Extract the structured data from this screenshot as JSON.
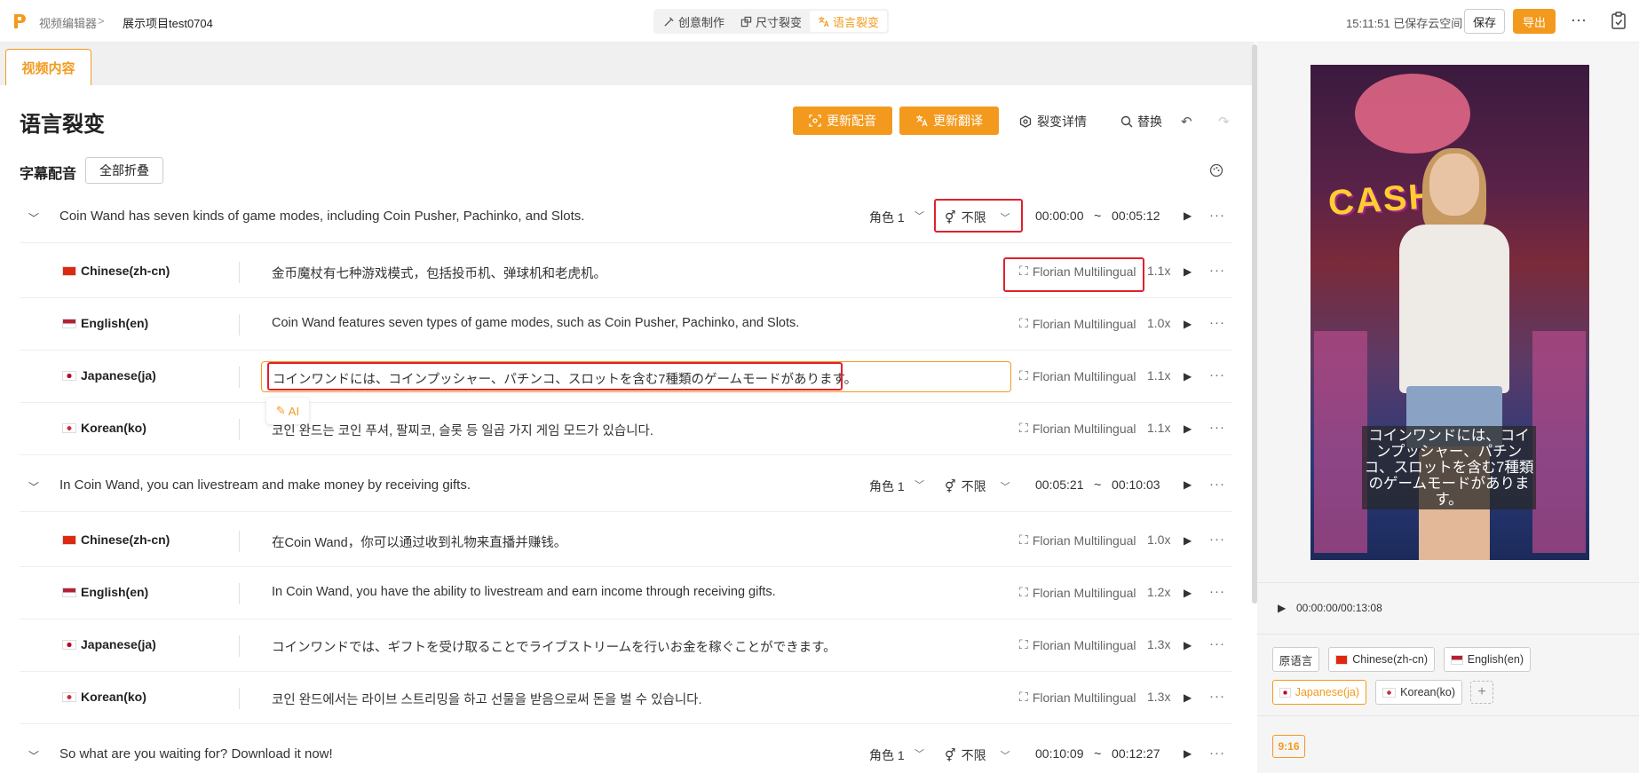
{
  "header": {
    "breadcrumb_root": "视频编辑器",
    "breadcrumb_sep": ">",
    "project_name": "展示项目test0704",
    "modes": [
      {
        "label": "创意制作",
        "icon": "creative-icon"
      },
      {
        "label": "尺寸裂变",
        "icon": "resize-icon"
      },
      {
        "label": "语言裂变",
        "icon": "translate-icon",
        "active": true
      }
    ],
    "save_status": "15:11:51 已保存云空间",
    "save_label": "保存",
    "export_label": "导出",
    "more": "···"
  },
  "tabs": {
    "video_content": "视频内容"
  },
  "toolbar": {
    "title": "语言裂变",
    "update_dub": "更新配音",
    "update_translate": "更新翻译",
    "detail": "裂变详情",
    "replace": "替换",
    "undo": "↶",
    "redo": "↷"
  },
  "subtitle_dub": {
    "label": "字幕配音",
    "collapse_all": "全部折叠"
  },
  "segments": [
    {
      "text": "Coin Wand has seven kinds of game modes, including Coin Pusher, Pachinko, and Slots.",
      "role": "角色 1",
      "gender": "不限",
      "start": "00:00:00",
      "tilde": "~",
      "end": "00:05:12",
      "langs": [
        {
          "name": "Chinese(zh-cn)",
          "text": "金币魔杖有七种游戏模式，包括投币机、弹球机和老虎机。",
          "voice": "Florian Multilingual",
          "speed": "1.1x"
        },
        {
          "name": "English(en)",
          "text": "Coin Wand features seven types of game modes, such as Coin Pusher, Pachinko, and Slots.",
          "voice": "Florian Multilingual",
          "speed": "1.0x"
        },
        {
          "name": "Japanese(ja)",
          "text": "コインワンドには、コインプッシャー、パチンコ、スロットを含む7種類のゲームモードがあります。",
          "voice": "Florian Multilingual",
          "speed": "1.1x"
        },
        {
          "name": "Korean(ko)",
          "text": "코인 완드는 코인 푸셔, 팔찌코, 슬롯 등 일곱 가지 게임 모드가 있습니다.",
          "voice": "Florian Multilingual",
          "speed": "1.1x"
        }
      ]
    },
    {
      "text": "In Coin Wand, you can livestream and make money by receiving gifts.",
      "role": "角色 1",
      "gender": "不限",
      "start": "00:05:21",
      "tilde": "~",
      "end": "00:10:03",
      "langs": [
        {
          "name": "Chinese(zh-cn)",
          "text": "在Coin Wand，你可以通过收到礼物来直播并赚钱。",
          "voice": "Florian Multilingual",
          "speed": "1.0x"
        },
        {
          "name": "English(en)",
          "text": "In Coin Wand, you have the ability to livestream and earn income through receiving gifts.",
          "voice": "Florian Multilingual",
          "speed": "1.2x"
        },
        {
          "name": "Japanese(ja)",
          "text": "コインワンドでは、ギフトを受け取ることでライブストリームを行いお金を稼ぐことができます。",
          "voice": "Florian Multilingual",
          "speed": "1.3x"
        },
        {
          "name": "Korean(ko)",
          "text": "코인 완드에서는 라이브 스트리밍을 하고 선물을 받음으로써 돈을 벌 수 있습니다.",
          "voice": "Florian Multilingual",
          "speed": "1.3x"
        }
      ]
    },
    {
      "text": "So what are you waiting for? Download it now!",
      "role": "角色 1",
      "gender": "不限",
      "start": "00:10:09",
      "tilde": "~",
      "end": "00:12:27"
    }
  ],
  "ai_chip": "AI",
  "preview": {
    "sign_text": "CASH",
    "subtitle": "コインワンドには、コインプッシャー、パチンコ、スロットを含む7種類のゲームモードがあります。",
    "time": "00:00:00/00:13:08",
    "langs": [
      "原语言",
      "Chinese(zh-cn)",
      "English(en)",
      "Japanese(ja)",
      "Korean(ko)"
    ],
    "add": "+",
    "ratio": "9:16"
  },
  "colors": {
    "accent": "#f39a1e",
    "highlight": "#e0202c"
  }
}
